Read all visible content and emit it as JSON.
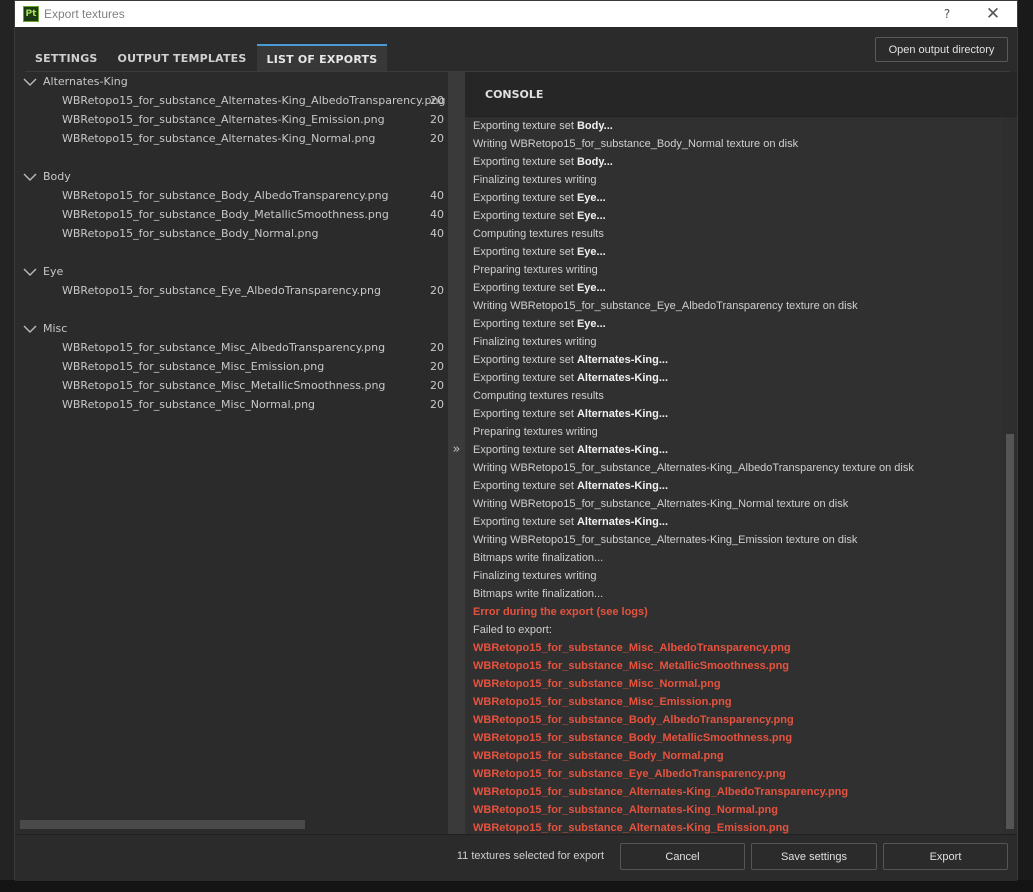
{
  "window": {
    "title": "Export textures",
    "app_badge": "Pt",
    "help": "?",
    "close": "✕"
  },
  "tabs": [
    {
      "label": "SETTINGS"
    },
    {
      "label": "OUTPUT TEMPLATES"
    },
    {
      "label": "LIST OF EXPORTS",
      "active": true
    }
  ],
  "open_dir_label": "Open output directory",
  "groups": [
    {
      "name": "Alternates-King",
      "files": [
        {
          "name": "WBRetopo15_for_substance_Alternates-King_AlbedoTransparency.png",
          "size": "20"
        },
        {
          "name": "WBRetopo15_for_substance_Alternates-King_Emission.png",
          "size": "20"
        },
        {
          "name": "WBRetopo15_for_substance_Alternates-King_Normal.png",
          "size": "20"
        }
      ]
    },
    {
      "name": "Body",
      "files": [
        {
          "name": "WBRetopo15_for_substance_Body_AlbedoTransparency.png",
          "size": "40"
        },
        {
          "name": "WBRetopo15_for_substance_Body_MetallicSmoothness.png",
          "size": "40"
        },
        {
          "name": "WBRetopo15_for_substance_Body_Normal.png",
          "size": "40"
        }
      ]
    },
    {
      "name": "Eye",
      "files": [
        {
          "name": "WBRetopo15_for_substance_Eye_AlbedoTransparency.png",
          "size": "20"
        }
      ]
    },
    {
      "name": "Misc",
      "files": [
        {
          "name": "WBRetopo15_for_substance_Misc_AlbedoTransparency.png",
          "size": "20"
        },
        {
          "name": "WBRetopo15_for_substance_Misc_Emission.png",
          "size": "20"
        },
        {
          "name": "WBRetopo15_for_substance_Misc_MetallicSmoothness.png",
          "size": "20"
        },
        {
          "name": "WBRetopo15_for_substance_Misc_Normal.png",
          "size": "20"
        }
      ]
    }
  ],
  "splitter_arrow": "»",
  "console": {
    "title": "CONSOLE",
    "lines": [
      {
        "text": "Exporting texture set ",
        "bold": "Body..."
      },
      {
        "text": "Writing WBRetopo15_for_substance_Body_Normal texture on disk"
      },
      {
        "text": "Exporting texture set ",
        "bold": "Body..."
      },
      {
        "text": "Finalizing textures writing"
      },
      {
        "text": "Exporting texture set ",
        "bold": "Eye..."
      },
      {
        "text": "Exporting texture set ",
        "bold": "Eye..."
      },
      {
        "text": "Computing textures results"
      },
      {
        "text": "Exporting texture set ",
        "bold": "Eye..."
      },
      {
        "text": "Preparing textures writing"
      },
      {
        "text": "Exporting texture set ",
        "bold": "Eye..."
      },
      {
        "text": "Writing WBRetopo15_for_substance_Eye_AlbedoTransparency texture on disk"
      },
      {
        "text": "Exporting texture set ",
        "bold": "Eye..."
      },
      {
        "text": "Finalizing textures writing"
      },
      {
        "text": "Exporting texture set ",
        "bold": "Alternates-King..."
      },
      {
        "text": "Exporting texture set ",
        "bold": "Alternates-King..."
      },
      {
        "text": "Computing textures results"
      },
      {
        "text": "Exporting texture set ",
        "bold": "Alternates-King..."
      },
      {
        "text": "Preparing textures writing"
      },
      {
        "text": "Exporting texture set ",
        "bold": "Alternates-King..."
      },
      {
        "text": "Writing WBRetopo15_for_substance_Alternates-King_AlbedoTransparency texture on disk"
      },
      {
        "text": "Exporting texture set ",
        "bold": "Alternates-King..."
      },
      {
        "text": "Writing WBRetopo15_for_substance_Alternates-King_Normal texture on disk"
      },
      {
        "text": "Exporting texture set ",
        "bold": "Alternates-King..."
      },
      {
        "text": "Writing WBRetopo15_for_substance_Alternates-King_Emission texture on disk"
      },
      {
        "text": "Bitmaps write finalization..."
      },
      {
        "text": "Finalizing textures writing"
      },
      {
        "text": "Bitmaps write finalization..."
      },
      {
        "text": "Error during the export (see logs)",
        "error": true
      },
      {
        "text": "Failed to export:"
      },
      {
        "text": "WBRetopo15_for_substance_Misc_AlbedoTransparency.png",
        "error": true
      },
      {
        "text": "WBRetopo15_for_substance_Misc_MetallicSmoothness.png",
        "error": true
      },
      {
        "text": "WBRetopo15_for_substance_Misc_Normal.png",
        "error": true
      },
      {
        "text": "WBRetopo15_for_substance_Misc_Emission.png",
        "error": true
      },
      {
        "text": "WBRetopo15_for_substance_Body_AlbedoTransparency.png",
        "error": true
      },
      {
        "text": "WBRetopo15_for_substance_Body_MetallicSmoothness.png",
        "error": true
      },
      {
        "text": "WBRetopo15_for_substance_Body_Normal.png",
        "error": true
      },
      {
        "text": "WBRetopo15_for_substance_Eye_AlbedoTransparency.png",
        "error": true
      },
      {
        "text": "WBRetopo15_for_substance_Alternates-King_AlbedoTransparency.png",
        "error": true
      },
      {
        "text": "WBRetopo15_for_substance_Alternates-King_Normal.png",
        "error": true
      },
      {
        "text": "WBRetopo15_for_substance_Alternates-King_Emission.png",
        "error": true
      }
    ]
  },
  "footer": {
    "count_text": "11 textures selected for export",
    "cancel_label": "Cancel",
    "save_label": "Save settings",
    "export_label": "Export"
  },
  "colors": {
    "accent": "#4a9ad6",
    "error": "#e5533f",
    "app_badge": "#6aa531"
  }
}
